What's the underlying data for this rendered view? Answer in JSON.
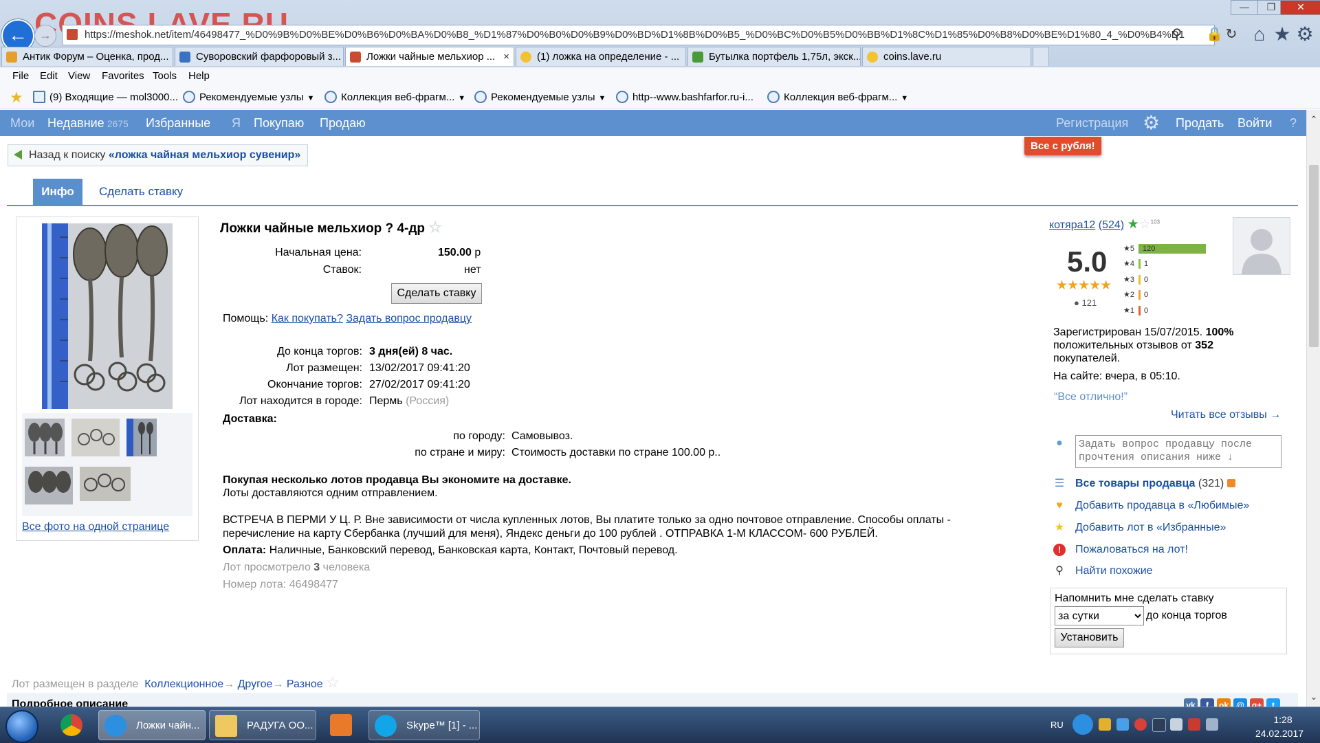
{
  "browser": {
    "watermark": "COINS.LAVE.RU",
    "address": "https://meshok.net/item/46498477_%D0%9B%D0%BE%D0%B6%D0%BA%D0%B8_%D1%87%D0%B0%D0%B9%D0%BD%D1%8B%D0%B5_%D0%BC%D0%B5%D0%BB%D1%8C%D1%85%D0%B8%D0%BE%D1%80_4_%D0%B4%D1%80",
    "tabs": [
      {
        "label": "Антик Форум – Оценка, прод...",
        "favicon": "forum-icon",
        "color": "#e3a12c"
      },
      {
        "label": "Суворовский фарфоровый з...",
        "favicon": "mail-icon",
        "color": "#3a72c2"
      },
      {
        "label": "Ложки чайные мельхиор ...",
        "favicon": "meshok-icon",
        "color": "#c84b32",
        "active": true
      },
      {
        "label": "(1) ложка на определение - ...",
        "favicon": "smile-icon",
        "color": "#f2c230"
      },
      {
        "label": "Бутылка портфель 1,75л, экск...",
        "favicon": "bottle-icon",
        "color": "#4a9a3b"
      },
      {
        "label": "coins.lave.ru",
        "favicon": "smile-icon",
        "color": "#f2c230"
      }
    ],
    "tab_close": "×",
    "menu": [
      "File",
      "Edit",
      "View",
      "Favorites",
      "Tools",
      "Help"
    ],
    "favorites": [
      "(9) Входящие — mol3000...",
      "Рекомендуемые узлы",
      "Коллекция веб-фрагм...",
      "Рекомендуемые узлы",
      "http--www.bashfarfor.ru-i...",
      "Коллекция веб-фрагм..."
    ]
  },
  "site_nav": {
    "my": "Мои",
    "recent": "Недавние",
    "recent_count": "2675",
    "favorites": "Избранные",
    "me": "Я",
    "buying": "Покупаю",
    "selling": "Продаю",
    "register": "Регистрация",
    "sell": "Продать",
    "login": "Войти",
    "help": "?",
    "promo_badge": "Все с рубля!"
  },
  "back_search": {
    "prefix": "Назад к поиску",
    "query": "«ложка чайная мельхиор сувенир»"
  },
  "page_tabs": {
    "info": "Инфо",
    "bid": "Сделать ставку"
  },
  "photos": {
    "all_link": "Все фото на одной странице"
  },
  "lot": {
    "title": "Ложки чайные мельхиор ? 4-др",
    "start_price_label": "Начальная цена:",
    "start_price": "150.00",
    "currency": "р",
    "bids_label": "Ставок:",
    "bids": "нет",
    "bid_button": "Сделать ставку",
    "help_label": "Помощь:",
    "help_how": "Как покупать?",
    "help_ask": "Задать вопрос продавцу",
    "time_left_label": "До конца торгов:",
    "time_left": "3 дня(ей) 8 час.",
    "placed_label": "Лот размещен:",
    "placed": "13/02/2017 09:41:20",
    "ends_label": "Окончание торгов:",
    "ends": "27/02/2017 09:41:20",
    "city_label": "Лот находится в городе:",
    "city": "Пермь",
    "country": "(Россия)",
    "delivery_label": "Доставка:",
    "delivery_city_label": "по городу:",
    "delivery_city": "Самовывоз.",
    "delivery_world_label": "по стране и миру:",
    "delivery_world": "Стоимость доставки по стране 100.00 р..",
    "multi_bold": "Покупая несколько лотов продавца Вы экономите на доставке.",
    "multi_note": "Лоты доставляются одним отправлением.",
    "meeting_1": "ВСТРЕЧА В ПЕРМИ У Ц. Р. Вне зависимости от числа купленных лотов, Вы платите только за одно почтовое отправление. Способы оплаты -",
    "meeting_2": "перечисление на карту Сбербанка (лучший для меня), Яндекс деньги до 100 рублей . ОТПРАВКА 1-М КЛАССОМ- 600 РУБЛЕЙ.",
    "payment_label": "Оплата:",
    "payment": "Наличные, Банковский перевод, Банковская карта, Контакт, Почтовый перевод.",
    "views_prefix": "Лот просмотрело",
    "views_count": "3",
    "views_suffix": "человека",
    "lot_number": "Номер лота: 46498477"
  },
  "seller": {
    "name": "котяра12",
    "reviews_count": "(524)",
    "stars_sup": "103",
    "rating": "5.0",
    "rating_stars": "★★★★★",
    "rating_people": "121",
    "breakdown": [
      {
        "label": "★5",
        "value": 120,
        "color": "#7cb342"
      },
      {
        "label": "★4",
        "value": 1,
        "color": "#8bc34a"
      },
      {
        "label": "★3",
        "value": 0,
        "color": "#e6c229"
      },
      {
        "label": "★2",
        "value": 0,
        "color": "#f0a030"
      },
      {
        "label": "★1",
        "value": 0,
        "color": "#e06030"
      }
    ],
    "registered_text": "Зарегистрирован 15/07/2015.",
    "positive_pct": "100%",
    "positive_text": "положительных отзывов от",
    "buyers_count": "352",
    "buyers_label": "покупателей.",
    "online": "На сайте: вчера, в 05:10.",
    "quote": "“Все отлично!”",
    "read_all": "Читать все отзывы →",
    "ask_placeholder": "Задать вопрос продавцу после прочтения описания ниже ↓",
    "all_goods": "Все товары продавца",
    "all_goods_count": "(321)",
    "add_favorite_seller": "Добавить продавца в «Любимые»",
    "add_favorite_lot": "Добавить лот в «Избранные»",
    "complain": "Пожаловаться на лот!",
    "find_similar": "Найти похожие",
    "remind_title": "Напомнить мне сделать ставку",
    "remind_option": "за сутки",
    "remind_suffix": "до конца торгов",
    "remind_button": "Установить"
  },
  "footer": {
    "category_prefix": "Лот размещен в разделе",
    "cat1": "Коллекционное",
    "cat2": "Другое",
    "cat3": "Разное",
    "arrow": "→",
    "detail_heading": "Подробное описание"
  },
  "taskbar": {
    "apps": [
      {
        "label": "Ложки чайн...",
        "icon": "ie-icon"
      },
      {
        "label": "РАДУГА ОО...",
        "icon": "folder-icon"
      },
      {
        "label": "Skype™ [1] - ...",
        "icon": "skype-icon"
      }
    ],
    "lang": "RU",
    "time": "1:28",
    "date": "24.02.2017"
  }
}
